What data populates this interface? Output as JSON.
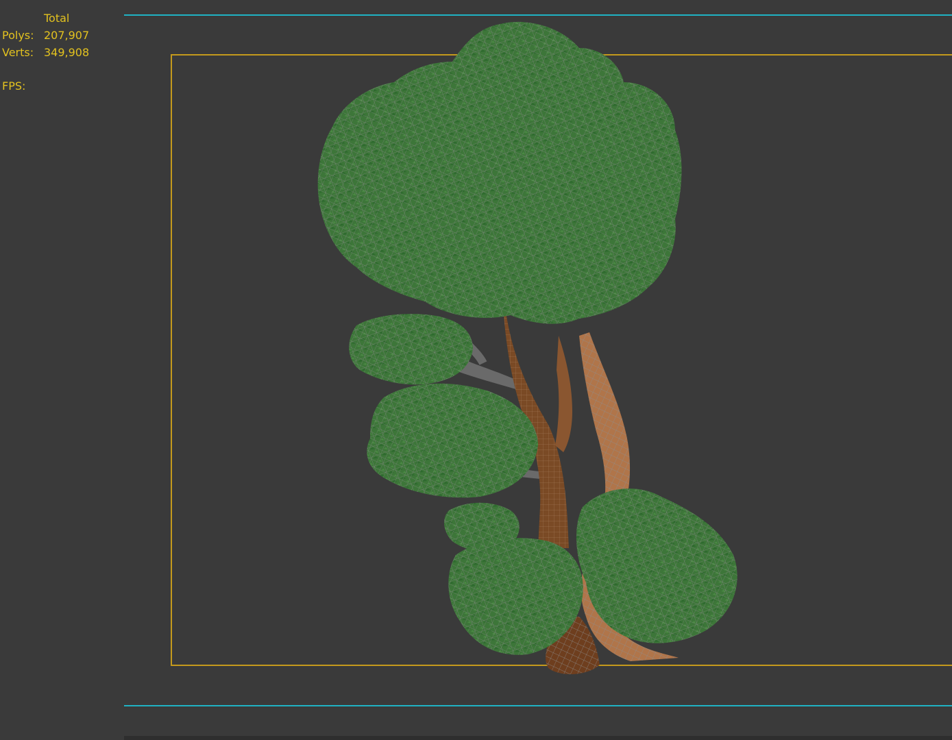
{
  "viewport": {
    "background": "#3a3a3a",
    "frame_color": "#c49a1c",
    "guide_color": "#1fb3c4"
  },
  "stats": {
    "header": "Total",
    "polys_label": "Polys:",
    "polys_value": "207,907",
    "verts_label": "Verts:",
    "verts_value": "349,908",
    "fps_label": "FPS:",
    "text_color": "#e3c21f"
  },
  "scene": {
    "object": "tree-model",
    "foliage_color": "#3f7a3c",
    "trunk_color": "#8a5630",
    "wire_color": "#8a8a8a"
  }
}
